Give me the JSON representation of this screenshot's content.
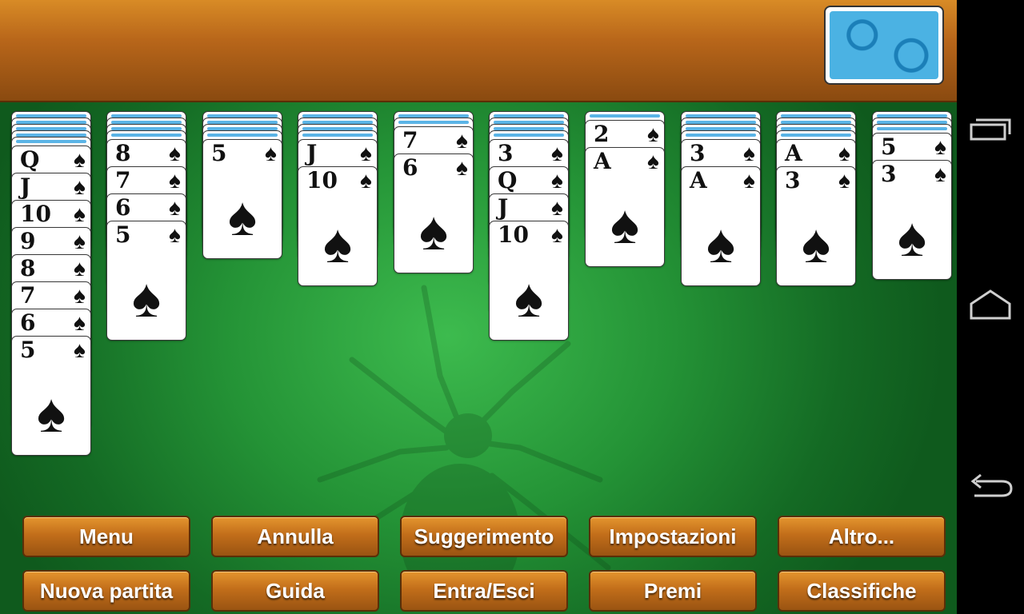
{
  "buttons_row1": [
    "Menu",
    "Annulla",
    "Suggerimento",
    "Impostazioni",
    "Altro..."
  ],
  "buttons_row2": [
    "Nuova partita",
    "Guida",
    "Entra/Esci",
    "Premi",
    "Classifiche"
  ],
  "suit_symbol": "♠",
  "columns": [
    {
      "down": 5,
      "up": [
        "Q",
        "J",
        "10",
        "9",
        "8",
        "7",
        "6",
        "5"
      ]
    },
    {
      "down": 4,
      "up": [
        "8",
        "7",
        "6",
        "5"
      ]
    },
    {
      "down": 4,
      "up": [
        "5"
      ]
    },
    {
      "down": 4,
      "up": [
        "J",
        "10"
      ]
    },
    {
      "down": 2,
      "up": [
        "7",
        "6"
      ]
    },
    {
      "down": 4,
      "up": [
        "3",
        "Q",
        "J",
        "10"
      ]
    },
    {
      "down": 1,
      "up": [
        "2",
        "A"
      ]
    },
    {
      "down": 4,
      "up": [
        "3",
        "A"
      ]
    },
    {
      "down": 4,
      "up": [
        "A",
        "3"
      ]
    },
    {
      "down": 3,
      "up": [
        "5",
        "3"
      ]
    }
  ],
  "colors": {
    "felt": "#249336",
    "bar": "#b8661a",
    "button": "#c26e1a",
    "card_back": "#4bb2e3"
  },
  "icons": [
    "recent-apps-icon",
    "home-icon",
    "back-icon",
    "spider-icon",
    "card-back"
  ]
}
